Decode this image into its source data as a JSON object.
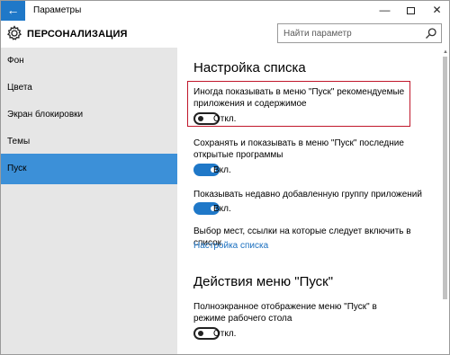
{
  "window": {
    "title": "Параметры",
    "back_glyph": "←",
    "minimize_glyph": "—",
    "close_glyph": "✕"
  },
  "header": {
    "section_title": "ПЕРСОНАЛИЗАЦИЯ",
    "search_placeholder": "Найти параметр"
  },
  "sidebar": {
    "items": [
      {
        "label": "Фон",
        "active": false
      },
      {
        "label": "Цвета",
        "active": false
      },
      {
        "label": "Экран блокировки",
        "active": false
      },
      {
        "label": "Темы",
        "active": false
      },
      {
        "label": "Пуск",
        "active": true
      }
    ]
  },
  "main": {
    "heading_list": "Настройка списка",
    "settings": [
      {
        "text": "Иногда показывать в меню \"Пуск\" рекомендуемые приложения и содержимое",
        "state": "Откл.",
        "on": false,
        "highlighted": true
      },
      {
        "text": "Сохранять и показывать в меню \"Пуск\" последние открытые программы",
        "state": "Вкл.",
        "on": true
      },
      {
        "text": "Показывать недавно добавленную группу приложений",
        "state": "Вкл.",
        "on": true
      }
    ],
    "places_text": "Выбор мест, ссылки на которые следует включить в список",
    "places_link": "Настройка списка",
    "heading_actions": "Действия меню \"Пуск\"",
    "fullscreen": {
      "text": "Полноэкранное отображение меню \"Пуск\" в режиме рабочего стола",
      "state": "Откл.",
      "on": false
    }
  },
  "colors": {
    "accent": "#1f78c8",
    "sidebar_active": "#3c90d8",
    "sidebar_bg": "#e6e6e6",
    "highlight_border": "#c0172b",
    "link": "#1a6fbf"
  }
}
